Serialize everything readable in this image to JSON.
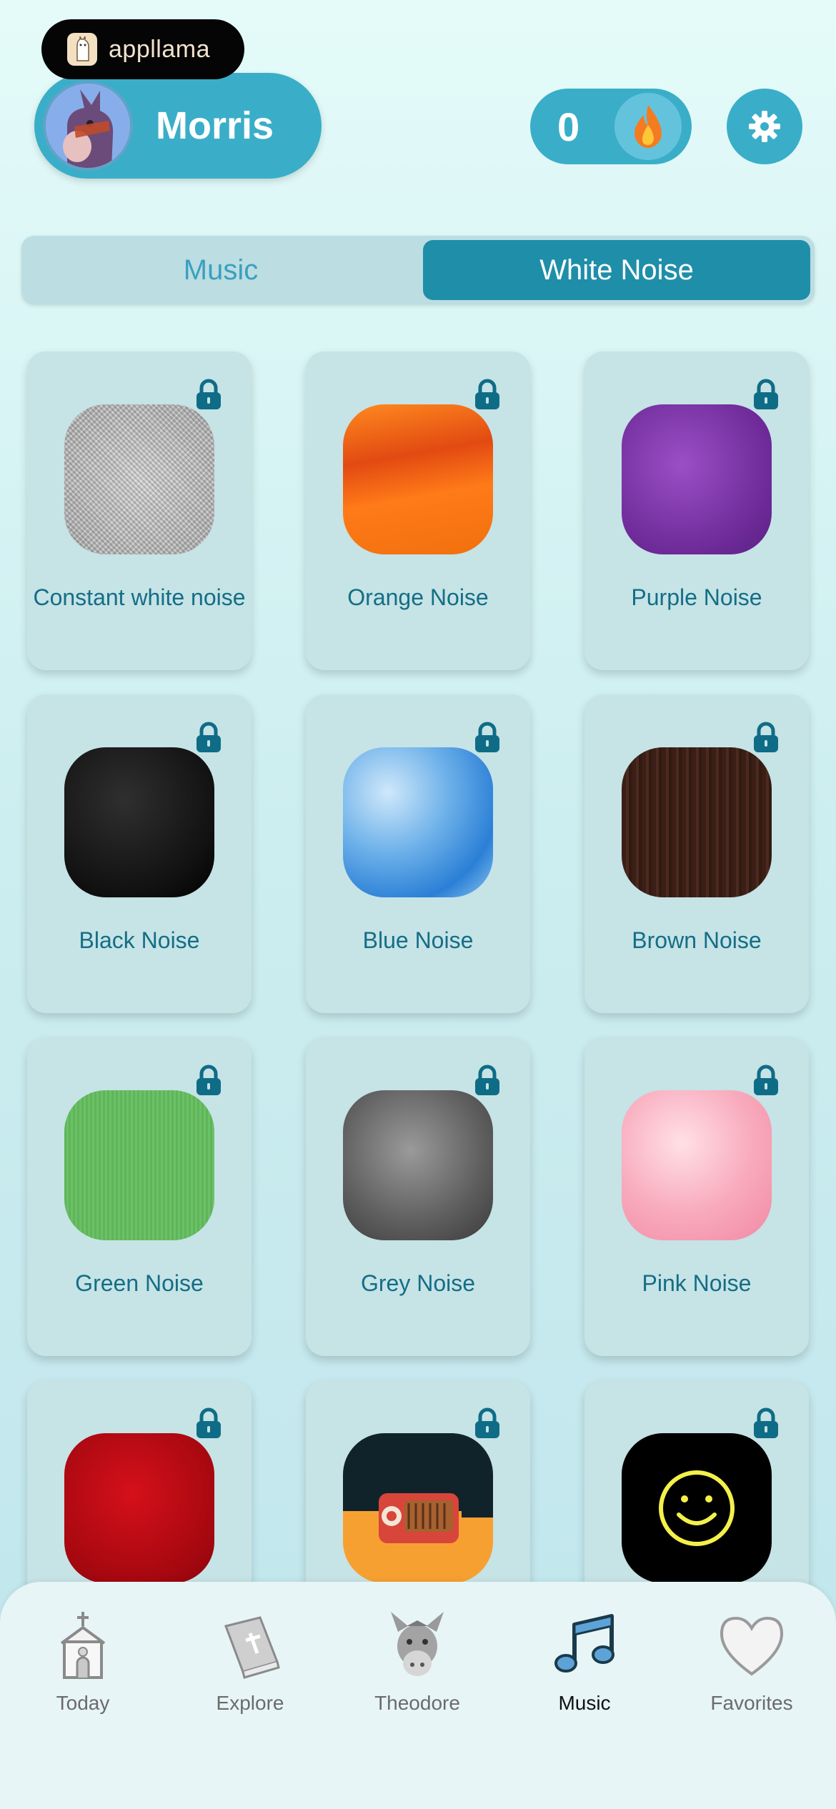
{
  "brand": {
    "name": "appllama"
  },
  "profile": {
    "name": "Morris"
  },
  "streak": {
    "count": "0"
  },
  "tabs": [
    {
      "label": "Music",
      "active": false
    },
    {
      "label": "White Noise",
      "active": true
    }
  ],
  "sounds": [
    {
      "label": "Constant white noise",
      "texture": "white-static",
      "locked": true
    },
    {
      "label": "Orange Noise",
      "texture": "orange-watercolor",
      "locked": true
    },
    {
      "label": "Purple Noise",
      "texture": "purple-watercolor",
      "locked": true
    },
    {
      "label": "Black Noise",
      "texture": "black-watercolor",
      "locked": true
    },
    {
      "label": "Blue Noise",
      "texture": "blue-watercolor",
      "locked": true
    },
    {
      "label": "Brown Noise",
      "texture": "brown-wood",
      "locked": true
    },
    {
      "label": "Green Noise",
      "texture": "green-fabric",
      "locked": true
    },
    {
      "label": "Grey Noise",
      "texture": "grey-watercolor",
      "locked": true
    },
    {
      "label": "Pink Noise",
      "texture": "pink-watercolor",
      "locked": true
    },
    {
      "label": "",
      "texture": "red-velvet",
      "locked": true
    },
    {
      "label": "",
      "texture": "retro-radio",
      "locked": true
    },
    {
      "label": "",
      "texture": "neon-smiley",
      "locked": true
    }
  ],
  "nav": [
    {
      "label": "Today",
      "icon": "church-icon",
      "active": false
    },
    {
      "label": "Explore",
      "icon": "bible-icon",
      "active": false
    },
    {
      "label": "Theodore",
      "icon": "donkey-icon",
      "active": false
    },
    {
      "label": "Music",
      "icon": "music-note-icon",
      "active": true
    },
    {
      "label": "Favorites",
      "icon": "heart-icon",
      "active": false
    }
  ],
  "colors": {
    "accent": "#3aaec8",
    "active_tab": "#1f8ea9",
    "card": "#c6e3e6",
    "label": "#146e86"
  }
}
